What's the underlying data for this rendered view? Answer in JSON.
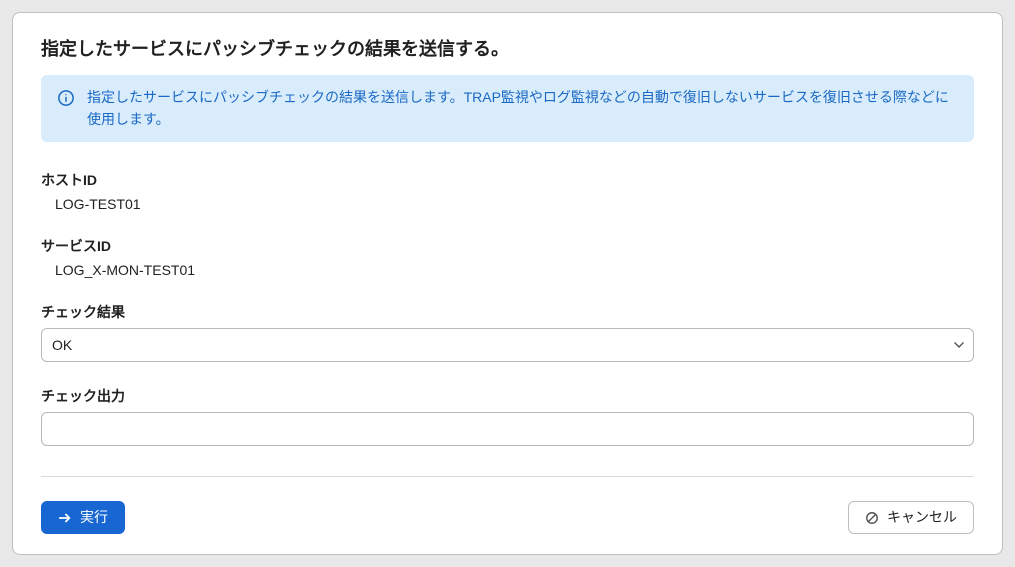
{
  "panel": {
    "title": "指定したサービスにパッシブチェックの結果を送信する。",
    "info_text": "指定したサービスにパッシブチェックの結果を送信します。TRAP監視やログ監視などの自動で復旧しないサービスを復旧させる際などに使用します。"
  },
  "fields": {
    "host_id": {
      "label": "ホストID",
      "value": "LOG-TEST01"
    },
    "service_id": {
      "label": "サービスID",
      "value": "LOG_X-MON-TEST01"
    },
    "check_result": {
      "label": "チェック結果",
      "selected": "OK"
    },
    "check_output": {
      "label": "チェック出力",
      "value": ""
    }
  },
  "actions": {
    "execute_label": "実行",
    "cancel_label": "キャンセル"
  }
}
